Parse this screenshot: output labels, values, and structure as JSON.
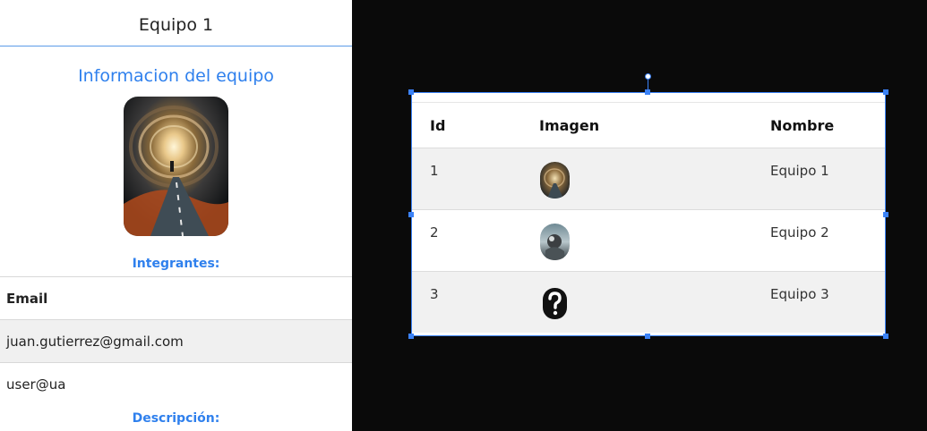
{
  "panel": {
    "title": "Equipo 1",
    "section_title": "Informacion del equipo",
    "members_heading": "Integrantes:",
    "members_column": "Email",
    "members": [
      {
        "email": "juan.gutierrez@gmail.com"
      },
      {
        "email": "user@ua"
      }
    ],
    "description_heading": "Descripción:"
  },
  "table": {
    "columns": [
      "Id",
      "Imagen",
      "Nombre"
    ],
    "rows": [
      {
        "id": "1",
        "image": "galaxy-avatar",
        "name": "Equipo 1"
      },
      {
        "id": "2",
        "image": "creature-avatar",
        "name": "Equipo 2"
      },
      {
        "id": "3",
        "image": "question-mark-icon",
        "name": "Equipo 3"
      }
    ]
  },
  "colors": {
    "accent": "#2f80ed",
    "selection": "#3b82f6",
    "canvas": "#0a0a0a"
  }
}
